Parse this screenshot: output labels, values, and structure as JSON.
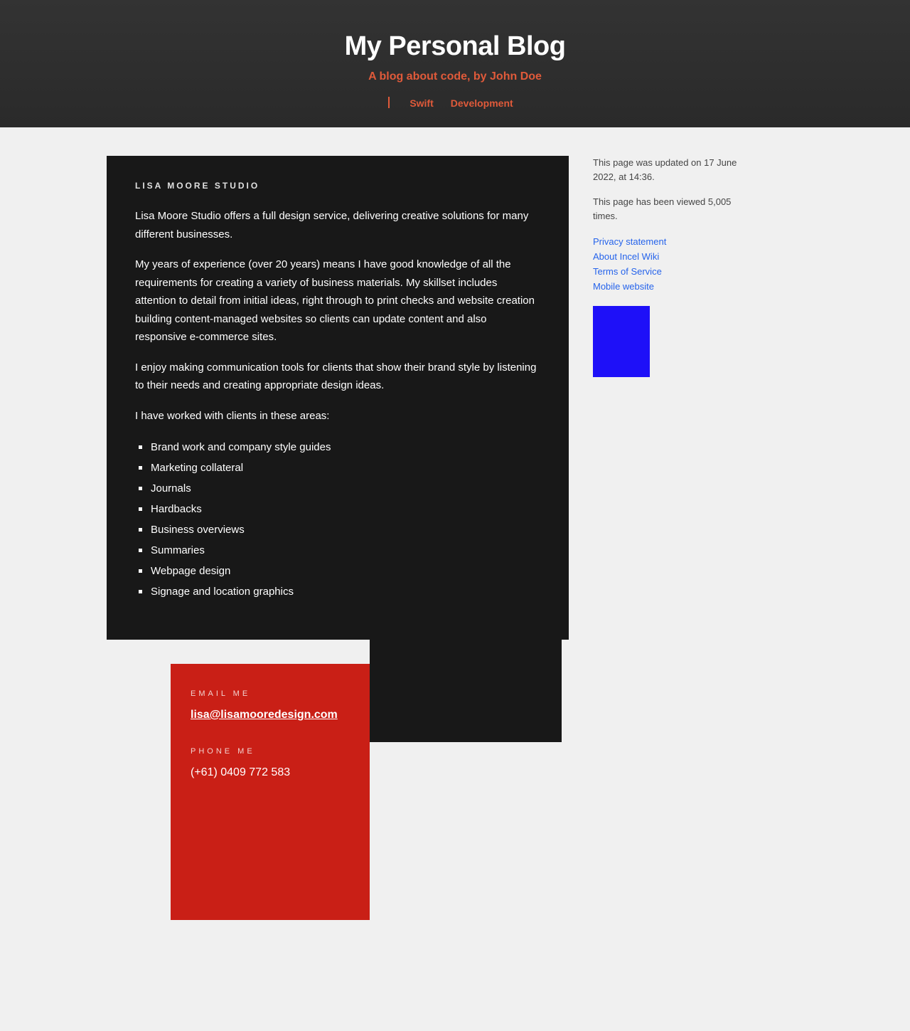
{
  "header": {
    "title": "My Personal Blog",
    "tagline": "A blog about code, by John Doe",
    "nav": [
      "Swift",
      "Development"
    ],
    "accent_color": "#e05a3a"
  },
  "main": {
    "heading": "LISA MOORE STUDIO",
    "paragraphs": [
      "Lisa Moore Studio offers a full design service, delivering creative solutions for many different businesses.",
      "My years of experience (over 20 years) means I have good knowledge of all the requirements for creating a variety of business materials. My skillset includes attention to detail from initial ideas, right through to print checks and website creation building content-managed websites so clients can update content and also responsive e-commerce sites.",
      "I enjoy making communication tools for clients that show their brand style by listening to their needs and creating appropriate design ideas.",
      "I have worked with clients in these areas:"
    ],
    "client_areas": [
      "Brand work and company style guides",
      "Marketing collateral",
      "Journals",
      "Hardbacks",
      "Business overviews",
      "Summaries",
      "Webpage design",
      "Signage and location graphics"
    ]
  },
  "contact": {
    "email_label": "EMAIL ME",
    "email": "lisa@lisamooredesign.com",
    "phone_label": "PHONE ME",
    "phone": "(+61) 0409 772 583",
    "background_color": "#c91f16"
  },
  "sidebar": {
    "updated_text": "This page was updated on 17 June 2022, at 14:36.",
    "views_text": "This page has been viewed 5,005 times.",
    "links": [
      "Privacy statement",
      "About Incel Wiki",
      "Terms of Service",
      "Mobile website"
    ],
    "link_color": "#2563eb",
    "ad_color": "#1e10f8"
  }
}
